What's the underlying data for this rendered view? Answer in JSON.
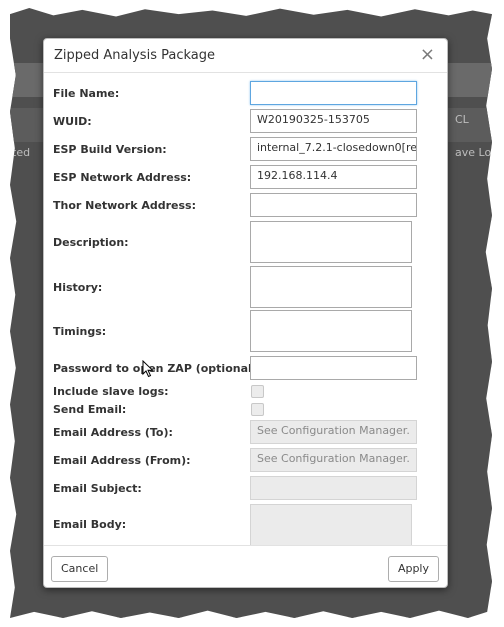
{
  "background": {
    "fragments": [
      "CL",
      "ted",
      "ave Lo"
    ]
  },
  "dialog": {
    "title": "Zipped Analysis Package",
    "close_icon": "×",
    "fields": {
      "file_name": {
        "label": "File Name:",
        "value": ""
      },
      "wuid": {
        "label": "WUID:",
        "value": "W20190325-153705"
      },
      "esp_build_version": {
        "label": "ESP Build Version:",
        "value": "internal_7.2.1-closedown0[re"
      },
      "esp_network_address": {
        "label": "ESP Network Address:",
        "value": "192.168.114.4"
      },
      "thor_network_address": {
        "label": "Thor Network Address:",
        "value": ""
      },
      "description": {
        "label": "Description:",
        "value": ""
      },
      "history": {
        "label": "History:",
        "value": ""
      },
      "timings": {
        "label": "Timings:",
        "value": ""
      },
      "password": {
        "label": "Password to open ZAP (optional):",
        "value": ""
      },
      "include_slave_logs": {
        "label": "Include slave logs:",
        "checked": false
      },
      "send_email": {
        "label": "Send Email:",
        "checked": false
      },
      "email_to": {
        "label": "Email Address (To):",
        "placeholder": "See Configuration Manager."
      },
      "email_from": {
        "label": "Email Address (From):",
        "placeholder": "See Configuration Manager."
      },
      "email_subject": {
        "label": "Email Subject:",
        "value": ""
      },
      "email_body": {
        "label": "Email Body:",
        "value": ""
      }
    },
    "buttons": {
      "cancel": "Cancel",
      "apply": "Apply"
    }
  },
  "colors": {
    "backdrop": "#4f4f4f",
    "focus_border": "#5ea6e0",
    "disabled_fill": "#ebebeb"
  }
}
